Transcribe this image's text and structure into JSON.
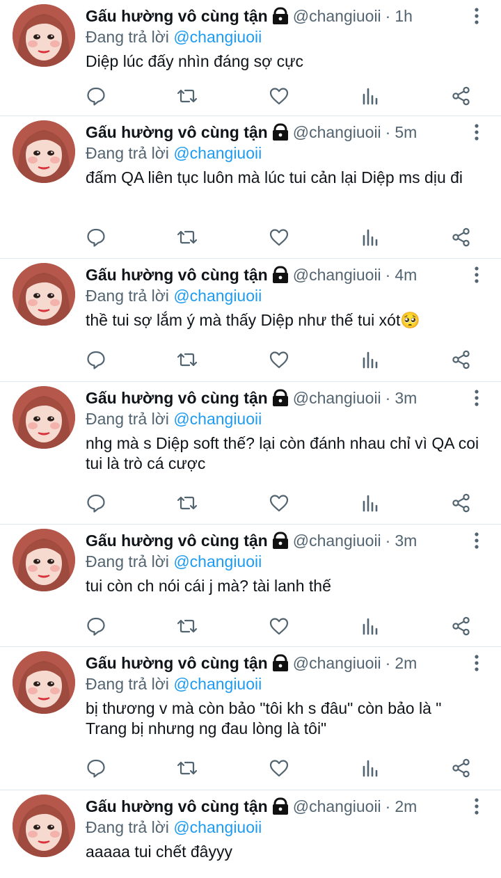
{
  "feed": {
    "tweets": [
      {
        "name": "Gấu hường vô cùng tận",
        "handle": "@changiuoii",
        "separator": "·",
        "time": "1h",
        "reply_prefix": "Đang trả lời",
        "reply_to": "@changiuoii",
        "text": "Diệp lúc đấy nhìn đáng sợ cực"
      },
      {
        "name": "Gấu hường vô cùng tận",
        "handle": "@changiuoii",
        "separator": "·",
        "time": "5m",
        "reply_prefix": "Đang trả lời",
        "reply_to": "@changiuoii",
        "text": "đấm QA liên tục luôn mà lúc tui cản lại Diệp ms dịu đi"
      },
      {
        "name": "Gấu hường vô cùng tận",
        "handle": "@changiuoii",
        "separator": "·",
        "time": "4m",
        "reply_prefix": "Đang trả lời",
        "reply_to": "@changiuoii",
        "text": "thề tui sợ lắm ý mà thấy Diệp như thế tui xót🥺"
      },
      {
        "name": "Gấu hường vô cùng tận",
        "handle": "@changiuoii",
        "separator": "·",
        "time": "3m",
        "reply_prefix": "Đang trả lời",
        "reply_to": "@changiuoii",
        "text": "nhg mà s Diệp soft thế? lại còn đánh nhau chỉ vì QA coi tui là trò cá cược"
      },
      {
        "name": "Gấu hường vô cùng tận",
        "handle": "@changiuoii",
        "separator": "·",
        "time": "3m",
        "reply_prefix": "Đang trả lời",
        "reply_to": "@changiuoii",
        "text": "tui còn ch nói cái j mà? tài lanh thế"
      },
      {
        "name": "Gấu hường vô cùng tận",
        "handle": "@changiuoii",
        "separator": "·",
        "time": "2m",
        "reply_prefix": "Đang trả lời",
        "reply_to": "@changiuoii",
        "text": "bị thương v mà còn bảo \"tôi kh s đâu\" còn bảo là \" Trang bị nhưng ng đau lòng là tôi\""
      },
      {
        "name": "Gấu hường vô cùng tận",
        "handle": "@changiuoii",
        "separator": "·",
        "time": "2m",
        "reply_prefix": "Đang trả lời",
        "reply_to": "@changiuoii",
        "text": "aaaaa tui chết đâyyy"
      }
    ]
  },
  "icons": {
    "protected": "lock-icon",
    "more": "more-vertical-icon",
    "reply": "reply-icon",
    "retweet": "retweet-icon",
    "like": "like-icon",
    "views": "views-icon",
    "share": "share-icon"
  },
  "colors": {
    "text": "#0f1419",
    "secondary": "#536471",
    "mention": "#1d9bf0",
    "divider": "#e1e8ed"
  }
}
